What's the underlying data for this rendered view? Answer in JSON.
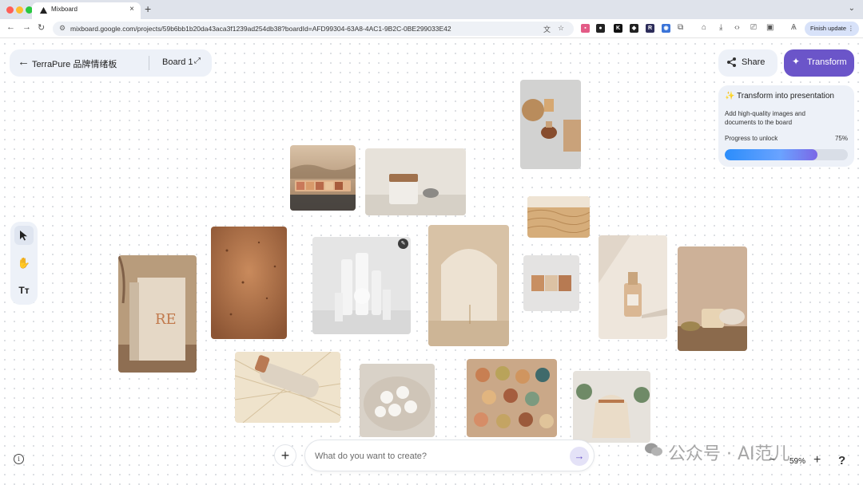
{
  "browser": {
    "tab_title": "Mixboard",
    "tab_close": "×",
    "new_tab": "+",
    "url": "mixboard.google.com/projects/59b6bb1b20da43aca3f1239ad254db38?boardId=AFD99304-63A8-4AC1-9B2C-0BE299033E42",
    "finish_update_label": "Finish update",
    "traffic_colors": [
      "#ff5f57",
      "#febc2e",
      "#28c840"
    ]
  },
  "header": {
    "board_title": "TerraPure 品牌情绪板",
    "board_name": "Board 1",
    "share_label": "Share",
    "transform_label": "Transform"
  },
  "promo": {
    "title": "✨ Transform into presentation",
    "description": "Add high-quality images and documents to the board",
    "progress_label": "Progress to unlock",
    "progress_percent_text": "75%",
    "progress_value": 0.75
  },
  "tools": [
    {
      "name": "select-tool",
      "icon": "cursor-icon",
      "glyph": "⬉"
    },
    {
      "name": "pan-tool",
      "icon": "hand-icon",
      "glyph": "✋"
    },
    {
      "name": "text-tool",
      "icon": "text-icon",
      "glyph": "Tт"
    }
  ],
  "prompt": {
    "placeholder": "What do you want to create?"
  },
  "zoom": {
    "value": "59%",
    "minus": "−",
    "plus": "+"
  },
  "help_label": "?",
  "watermark_text": "公众号 · AI范儿",
  "colors": {
    "accent": "#6b55c9",
    "panel": "#edf1f8"
  }
}
